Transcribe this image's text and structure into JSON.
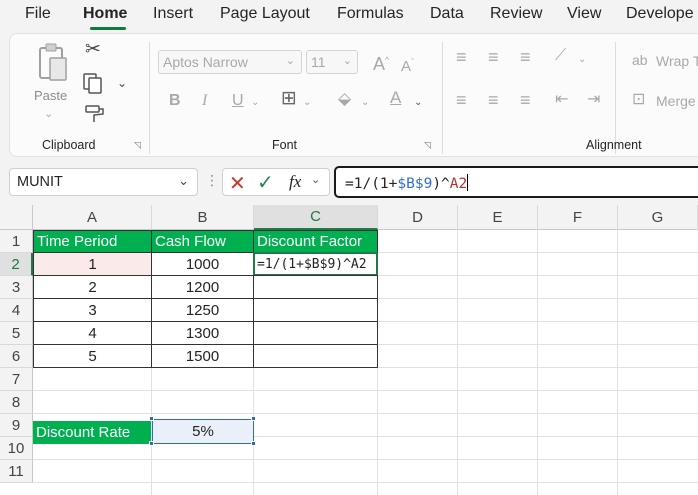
{
  "menu": {
    "items": [
      "File",
      "Home",
      "Insert",
      "Page Layout",
      "Formulas",
      "Data",
      "Review",
      "View",
      "Develope"
    ],
    "active": "Home"
  },
  "ribbon": {
    "clipboard": {
      "label": "Clipboard",
      "paste_label": "Paste"
    },
    "font": {
      "label": "Font",
      "font_name": "Aptos Narrow",
      "font_size": "11"
    },
    "alignment": {
      "label": "Alignment",
      "wrap_label": "Wrap T",
      "merge_label": "Merge"
    }
  },
  "formula_bar": {
    "name_box": "MUNIT",
    "formula_parts": {
      "prefix": "=1/(1+",
      "ref1": "$B$9",
      "middle": ")^",
      "ref2": "A2"
    }
  },
  "sheet": {
    "columns": [
      "A",
      "B",
      "C",
      "D",
      "E",
      "F",
      "G"
    ],
    "rows": [
      "1",
      "2",
      "3",
      "4",
      "5",
      "6",
      "7",
      "8",
      "9",
      "10",
      "11"
    ],
    "headers": {
      "a1": "Time Period",
      "b1": "Cash Flow",
      "c1": "Discount Factor"
    },
    "data_rows": [
      {
        "period": "1",
        "cash": "1000"
      },
      {
        "period": "2",
        "cash": "1200"
      },
      {
        "period": "3",
        "cash": "1250"
      },
      {
        "period": "4",
        "cash": "1300"
      },
      {
        "period": "5",
        "cash": "1500"
      }
    ],
    "c2_formula": "=1/(1+$B$9)^A2",
    "rate_label": "Discount Rate",
    "rate_value": "5%"
  },
  "colors": {
    "accent_green": "#00b050",
    "ref_blue": "#2f6fd0",
    "ref_red": "#b82e2e"
  }
}
